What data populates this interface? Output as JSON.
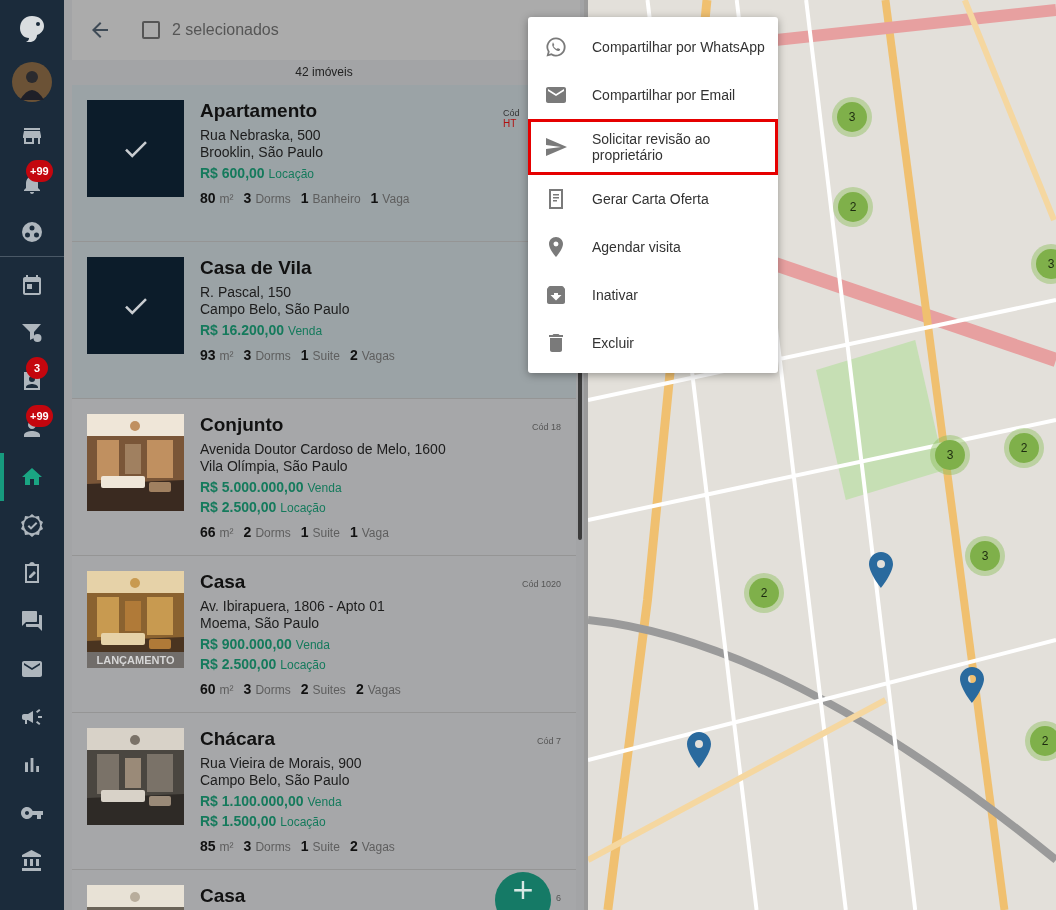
{
  "sidebar": {
    "groups": [
      {
        "items": [
          {
            "selected": false
          },
          {
            "selected": false,
            "badge": "+99"
          },
          {
            "selected": false
          }
        ]
      },
      {
        "items": [
          {
            "selected": false
          },
          {
            "selected": false
          },
          {
            "selected": false,
            "badge": "3"
          },
          {
            "selected": false,
            "badge": "+99"
          },
          {
            "selected": true
          },
          {
            "selected": false
          },
          {
            "selected": false
          },
          {
            "selected": false
          },
          {
            "selected": false
          },
          {
            "selected": false
          },
          {
            "selected": false
          },
          {
            "selected": false
          },
          {
            "selected": false
          }
        ]
      }
    ]
  },
  "header": {
    "checked": false,
    "label": "2 selecionados"
  },
  "count": "42 imóveis",
  "cards": [
    {
      "selected": true,
      "title": "Apartamento",
      "code": [
        "Cód",
        "HT"
      ],
      "address": [
        "Rua Nebraska, 500",
        "Brooklin, São Paulo"
      ],
      "prices": [
        {
          "value": "R$ 600,00",
          "type": "Locação"
        }
      ],
      "specs": [
        {
          "n": "80",
          "unit": "m²"
        },
        {
          "n": "3",
          "unit": "Dorms"
        },
        {
          "n": "1",
          "unit": "Banheiro"
        },
        {
          "n": "1",
          "unit": "Vaga"
        }
      ]
    },
    {
      "selected": true,
      "title": "Casa de Vila",
      "address": [
        "R. Pascal, 150",
        "Campo Belo, São Paulo"
      ],
      "prices": [
        {
          "value": "R$ 16.200,00",
          "type": "Venda"
        }
      ],
      "specs": [
        {
          "n": "93",
          "unit": "m²"
        },
        {
          "n": "3",
          "unit": "Dorms"
        },
        {
          "n": "1",
          "unit": "Suite"
        },
        {
          "n": "2",
          "unit": "Vagas"
        }
      ]
    },
    {
      "selected": false,
      "title": "Conjunto",
      "code": [
        "Cód 18"
      ],
      "address": [
        "Avenida Doutor Cardoso de Melo, 1600",
        "Vila Olímpia, São Paulo"
      ],
      "prices": [
        {
          "value": "R$ 5.000.000,00",
          "type": "Venda"
        },
        {
          "value": "R$ 2.500,00",
          "type": "Locação"
        }
      ],
      "specs": [
        {
          "n": "66",
          "unit": "m²"
        },
        {
          "n": "2",
          "unit": "Dorms"
        },
        {
          "n": "1",
          "unit": "Suite"
        },
        {
          "n": "1",
          "unit": "Vaga"
        }
      ]
    },
    {
      "selected": false,
      "title": "Casa",
      "code": [
        "Cód 1020"
      ],
      "tag": "LANÇAMENTO",
      "address": [
        "Av. Ibirapuera, 1806 - Apto 01",
        "Moema, São Paulo"
      ],
      "prices": [
        {
          "value": "R$ 900.000,00",
          "type": "Venda"
        },
        {
          "value": "R$ 2.500,00",
          "type": "Locação"
        }
      ],
      "specs": [
        {
          "n": "60",
          "unit": "m²"
        },
        {
          "n": "3",
          "unit": "Dorms"
        },
        {
          "n": "2",
          "unit": "Suites"
        },
        {
          "n": "2",
          "unit": "Vagas"
        }
      ]
    },
    {
      "selected": false,
      "title": "Chácara",
      "code": [
        "Cód 7"
      ],
      "address": [
        "Rua Vieira de Morais, 900",
        "Campo Belo, São Paulo"
      ],
      "prices": [
        {
          "value": "R$ 1.100.000,00",
          "type": "Venda"
        },
        {
          "value": "R$ 1.500,00",
          "type": "Locação"
        }
      ],
      "specs": [
        {
          "n": "85",
          "unit": "m²"
        },
        {
          "n": "3",
          "unit": "Dorms"
        },
        {
          "n": "1",
          "unit": "Suite"
        },
        {
          "n": "2",
          "unit": "Vagas"
        }
      ]
    },
    {
      "selected": false,
      "title": "Casa",
      "code": [
        "6"
      ]
    }
  ],
  "fab": "+",
  "map": {
    "kind": "picture",
    "markers": [
      {
        "kind": "cluster",
        "label": "3"
      },
      {
        "kind": "cluster",
        "label": "2"
      },
      {
        "kind": "cluster",
        "label": "3"
      },
      {
        "kind": "cluster",
        "label": "2"
      },
      {
        "kind": "cluster",
        "label": "3"
      },
      {
        "kind": "cluster",
        "label": "3"
      },
      {
        "kind": "cluster",
        "label": "2"
      },
      {
        "kind": "cluster",
        "label": "2"
      },
      {
        "kind": "pin"
      },
      {
        "kind": "pin"
      },
      {
        "kind": "pin"
      }
    ]
  },
  "menu": {
    "items": [
      {
        "label": "Compartilhar por WhatsApp",
        "highlighted": false
      },
      {
        "label": "Compartilhar por Email",
        "highlighted": false
      },
      {
        "label": "Solicitar revisão ao proprietário",
        "highlighted": true
      },
      {
        "label": "Gerar Carta Oferta",
        "highlighted": false
      },
      {
        "label": "Agendar visita",
        "highlighted": false
      },
      {
        "label": "Inativar",
        "highlighted": false
      },
      {
        "label": "Excluir",
        "highlighted": false
      }
    ]
  }
}
